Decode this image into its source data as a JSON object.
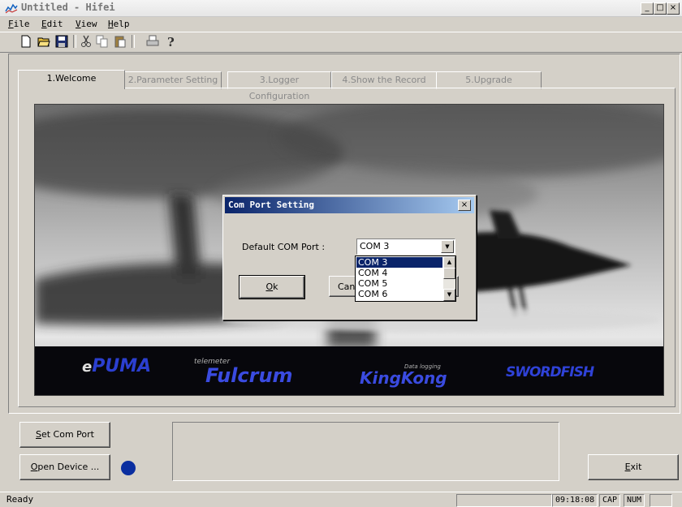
{
  "window": {
    "title": "Untitled - Hifei",
    "minimize": "_",
    "maximize": "□",
    "close": "×"
  },
  "menu": [
    {
      "key": "F",
      "rest": "ile"
    },
    {
      "key": "E",
      "rest": "dit"
    },
    {
      "key": "V",
      "rest": "iew"
    },
    {
      "key": "H",
      "rest": "elp"
    }
  ],
  "toolbar": {
    "icons": [
      "new-icon",
      "open-icon",
      "save-icon",
      "cut-icon",
      "copy-icon",
      "paste-icon",
      "print-icon",
      "help-icon"
    ]
  },
  "tabs": [
    "1.Welcome",
    "2.Parameter Setting",
    "3.Logger Configuration",
    "4.Show the Record",
    "5.Upgrade"
  ],
  "banner": {
    "brands": [
      "PUMA",
      "Fulcrum",
      "KingKong",
      "SWORDFISH"
    ],
    "fulcrum_tag": "telemeter",
    "kingkong_tag": "Data logging"
  },
  "dialog": {
    "title": "Com Port Setting",
    "close": "×",
    "label": "Default COM Port :",
    "selected": "COM 3",
    "options": [
      "COM 3",
      "COM 4",
      "COM 5",
      "COM 6"
    ],
    "ok_key": "O",
    "ok_rest": "k",
    "cancel_visible": "Canc"
  },
  "buttons": {
    "set_com_key": "S",
    "set_com_rest": "et Com Port",
    "open_key": "O",
    "open_rest": "pen Device ...",
    "exit_key": "E",
    "exit_rest": "xit"
  },
  "status": {
    "text": "Ready",
    "time": "09:18:08",
    "cap": "CAP",
    "num": "NUM"
  },
  "colors": {
    "led": "#0a2ea0",
    "dialog_title": "#0a246a",
    "selection": "#0a246a"
  }
}
